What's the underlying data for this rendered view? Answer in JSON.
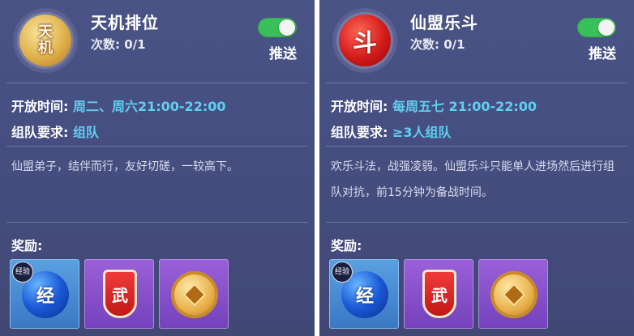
{
  "cards": [
    {
      "emblem_text": "天\n机",
      "title": "天机排位",
      "count_label": "次数: 0/1",
      "push_label": "推送",
      "push_enabled": true,
      "open_time_label": "开放时间:",
      "open_time_value": "周二、周六21:00-22:00",
      "team_req_label": "组队要求:",
      "team_req_value": "组队",
      "description": "仙盟弟子，结伴而行，友好切磋，一较高下。",
      "rewards_label": "奖励:",
      "rewards": [
        {
          "icon": "exp-orb-icon",
          "text": "经",
          "badge": "经验"
        },
        {
          "icon": "martial-shield-icon",
          "text": "武"
        },
        {
          "icon": "copper-coin-icon"
        }
      ]
    },
    {
      "emblem_text": "斗",
      "title": "仙盟乐斗",
      "count_label": "次数: 0/1",
      "push_label": "推送",
      "push_enabled": true,
      "open_time_label": "开放时间:",
      "open_time_value": "每周五七 21:00-22:00",
      "team_req_label": "组队要求:",
      "team_req_value": "≥3人组队",
      "description": "欢乐斗法，战强凌弱。仙盟乐斗只能单人进场然后进行组队对抗，前15分钟为备战时间。",
      "rewards_label": "奖励:",
      "rewards": [
        {
          "icon": "exp-orb-icon",
          "text": "经",
          "badge": "经验"
        },
        {
          "icon": "martial-shield-icon",
          "text": "武"
        },
        {
          "icon": "copper-coin-icon"
        }
      ]
    }
  ],
  "colors": {
    "panel_bg": "#4a5386",
    "value_cyan": "#5fd0f0",
    "toggle_on": "#3ac05a"
  }
}
